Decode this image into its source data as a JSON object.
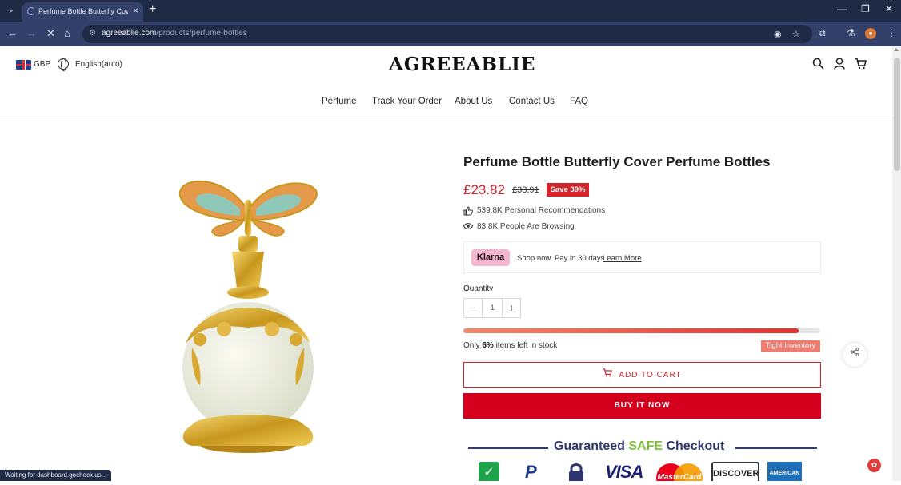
{
  "browser": {
    "tab_title": "Perfume Bottle Butterfly Cover Pe",
    "url_domain": "agreeablie.com",
    "url_path": "/products/perfume-bottles",
    "status_text": "Waiting for dashboard.gocheck.us..."
  },
  "header": {
    "currency": "GBP",
    "language": "English(auto)",
    "logo": "AGREEABLIE",
    "menu": [
      "Perfume",
      "Track Your Order",
      "About Us",
      "Contact Us",
      "FAQ"
    ]
  },
  "product": {
    "title": "Perfume Bottle Butterfly Cover Perfume Bottles",
    "price": "£23.82",
    "compare_price": "£38.91",
    "save_badge": "Save 39%",
    "recommendations": "539.8K Personal Recommendations",
    "browsing": "83.8K People Are Browsing"
  },
  "klarna": {
    "logo": "Klarna",
    "text": "Shop now. Pay in 30 days.",
    "link": "Learn More"
  },
  "quantity": {
    "label": "Quantity",
    "value": "1",
    "minus": "−",
    "plus": "+"
  },
  "stock": {
    "fill_fraction": 0.94,
    "prefix": "Only ",
    "percent": "6%",
    "suffix": " items left in stock",
    "badge": "Tight Inventory"
  },
  "actions": {
    "add_to_cart": "ADD TO CART",
    "buy_now": "BUY IT NOW"
  },
  "guarantee": {
    "part1": "Guaranteed ",
    "safe": "SAFE",
    "part2": " Checkout"
  },
  "payments": {
    "paypal": "P",
    "visa": "VISA",
    "mastercard": "MasterCard",
    "discover": "DISCOVER",
    "amex": "AMERICAN"
  },
  "colors": {
    "accent_red": "#d4232a",
    "buy_now_red": "#d4001e",
    "chrome_navy": "#33416a",
    "klarna_pink": "#f5b6cf",
    "safe_green": "#7ec13a",
    "guarantee_navy": "#30386e"
  }
}
